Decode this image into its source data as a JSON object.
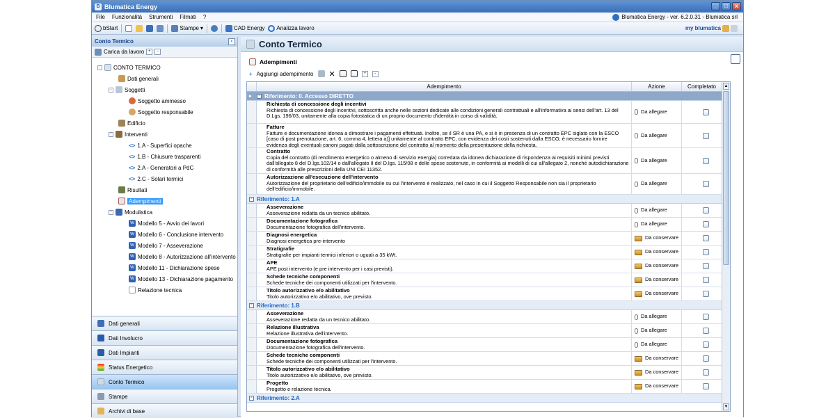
{
  "window": {
    "title": "Blumatica Energy",
    "version_info": "Blumatica Energy - ver. 6.2.0.31 - Blumatica srl"
  },
  "menu": [
    "File",
    "Funzionalità",
    "Strumenti",
    "Filmati",
    "?"
  ],
  "toolbar": {
    "bstart": "bStart",
    "stampe": "Stampe",
    "cad": "CAD Energy",
    "analizza": "Analizza lavoro",
    "brand": "my blumatica"
  },
  "left": {
    "header": "Conto Termico",
    "load": "Carica da lavoro",
    "tree": {
      "root": "CONTO TERMICO",
      "dati_generali": "Dati generali",
      "soggetti": "Soggetti",
      "soggetto_ammesso": "Soggetto ammesso",
      "soggetto_responsabile": "Soggetto responsabile",
      "edificio": "Edificio",
      "interventi": "Interventi",
      "int_1a": "1.A - Superfici opache",
      "int_1b": "1.B - Chiusure trasparenti",
      "int_2a": "2.A - Generatori a PdC",
      "int_2c": "2.C - Solari termici",
      "risultati": "Risultati",
      "adempimenti": "Adempimenti",
      "modulistica": "Modulistica",
      "mod5": "Modello 5 - Avvio dei lavori",
      "mod6": "Modello 6 - Conclusione intervento",
      "mod7": "Modello 7 - Asseverazione",
      "mod8": "Modello 8 - Autorizzazione all'intervento",
      "mod11": "Modello 11 - Dichiarazione spese",
      "mod13": "Modello 13 - Dichiarazione pagamento",
      "relazione": "Relazione tecnica"
    },
    "nav": [
      "Dati generali",
      "Dati Involucro",
      "Dati Impianti",
      "Status Energetico",
      "Conto Termico",
      "Stampe",
      "Archivi di base"
    ]
  },
  "main": {
    "title": "Conto Termico",
    "section": "Adempimenti",
    "add_label": "Aggiungi adempimento",
    "columns": {
      "adempimento": "Adempimento",
      "azione": "Azione",
      "completato": "Completato"
    },
    "groups": {
      "g0": "Riferimento: 0. Accesso DIRETTO",
      "g1": "Riferimento: 1.A",
      "g2": "Riferimento: 1.B",
      "g3": "Riferimento: 2.A"
    },
    "rows": [
      {
        "t": "Richiesta di concessione degli incentivi",
        "d": "Richiesta di concessione degli incentivi, sottoscritta anche nelle sezioni dedicate alle condizioni generali contrattuali e all'informativa ai sensi dell'art. 13 del D.Lgs. 196/03, unitamente alla copia fotostatica di un proprio documento d'identità in corso di validità.",
        "a": "Da allegare"
      },
      {
        "t": "Fatture",
        "d": "Fatture e documentazione idonea a dimostrare i pagamenti effettuati. Inoltre, se il SR è una PA, e si è in presenza di un contratto EPC siglato con la ESCO [caso di post prenotazione, art. 6, comma 4, lettera a)] unitamente al contratto EPC, con evidenza dei costi sostenuti dalla ESCO, è necessario fornire evidenza degli eventuali canoni pagati dalla sottoscrizione del contratto al momento della presentazione della richiesta.",
        "a": "Da allegare"
      },
      {
        "t": "Contratto",
        "d": "Copia del contratto (di rendimento energetico o almeno di servizio energia) corredata da idonea dichiarazione di rispondenza ai requisiti minimi previsti dall'allegato 8 del D.lgs.102/14 o dall'allegato II del D.lgs. 115/08 e delle spese sostenute, in conformità ai modelli di cui all'allegato 2, nonché autodichiarazione di conformità alle prescrizioni della UNI CEI 11352.",
        "a": "Da allegare"
      },
      {
        "t": "Autorizzazione all'esecuzione dell'intervento",
        "d": "Autorizzazione del proprietario dell'edificio/immobile su cui l'intervento è realizzato, nel caso in cui il Soggetto Responsabile non sia il proprietario dell'edificio/immobile.",
        "a": "Da allegare"
      },
      {
        "t": "Asseverazione",
        "d": "Asseverazione redatta da un tecnico abilitato.",
        "a": "Da allegare"
      },
      {
        "t": "Documentazione fotografica",
        "d": "Documentazione fotografica dell'intervento.",
        "a": "Da allegare"
      },
      {
        "t": "Diagnosi energetica",
        "d": "Diagnosi energetica pre-intervento",
        "a": "Da conservare"
      },
      {
        "t": "Stratigrafie",
        "d": "Stratigrafie per impianti termici inferiori o uguali a 35 kWt.",
        "a": "Da conservare"
      },
      {
        "t": "APE",
        "d": "APE post intervento (e pre intervento per i casi previsti).",
        "a": "Da conservare"
      },
      {
        "t": "Schede tecniche componenti",
        "d": "Schede tecniche dei componenti utilizzati per l'intervento.",
        "a": "Da conservare"
      },
      {
        "t": "Titolo autorizzativo e/o abilitativo",
        "d": "Titolo autorizzativo e/o abilitativo, ove previsto.",
        "a": "Da conservare"
      },
      {
        "t": "Asseverazione",
        "d": "Asseverazione redatta da un tecnico abilitato.",
        "a": "Da allegare"
      },
      {
        "t": "Relazione illustrativa",
        "d": "Relazione illustrativa dell'intervento.",
        "a": "Da allegare"
      },
      {
        "t": "Documentazione fotografica",
        "d": "Documentazione fotografica dell'intervento.",
        "a": "Da allegare"
      },
      {
        "t": "Schede tecniche componenti",
        "d": "Schede tecniche dei componenti utilizzati per l'intervento.",
        "a": "Da conservare"
      },
      {
        "t": "Titolo autorizzativo e/o abilitativo",
        "d": "Titolo autorizzativo e/o abilitativo, ove previsto.",
        "a": "Da conservare"
      },
      {
        "t": "Progetto",
        "d": "Progetto e relazione tecnica.",
        "a": "Da conservare"
      }
    ]
  }
}
